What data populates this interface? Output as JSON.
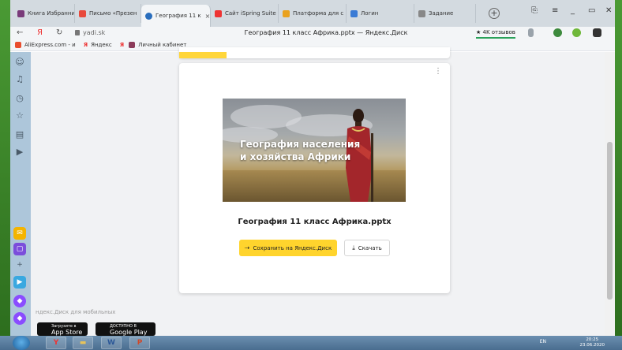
{
  "tabs": [
    {
      "label": "Книга Избранни",
      "icon": "book-icon",
      "color": "#7a3b7a"
    },
    {
      "label": "Письмо «Презен",
      "icon": "mail-icon",
      "color": "#e84a3c"
    },
    {
      "label": "География 11 к",
      "icon": "yadisk-icon",
      "color": "#2a6ebd",
      "active": true
    },
    {
      "label": "Сайт iSpring Suite",
      "icon": "yandex-icon",
      "color": "#e33"
    },
    {
      "label": "Платформа для с",
      "icon": "platform-icon",
      "color": "#e9a21f"
    },
    {
      "label": "Логин",
      "icon": "go-icon",
      "color": "#3a7bd5"
    },
    {
      "label": "Задание",
      "icon": "task-icon",
      "color": "#888"
    }
  ],
  "tab_close": "×",
  "newtab": "+",
  "window_controls": {
    "bookmark": "⎘",
    "menu": "≡",
    "minimize": "_",
    "restore": "▭",
    "close": "✕"
  },
  "address": {
    "back": "←",
    "yandex": "Я",
    "reload": "↻",
    "domain": "yadi.sk",
    "page_title": "География 11 класс Африка.pptx — Яндекс.Диск",
    "reviews": "★ 4K отзывов"
  },
  "bookmarks": [
    {
      "label": "AliExpress.com - и",
      "icon": "aliexpress-icon",
      "color": "#e94e2e"
    },
    {
      "label": "Яндекс",
      "icon": "yandex-icon",
      "color": "#e33"
    },
    {
      "label": "Личный кабинет",
      "icon": "cabinet-icon",
      "color": "#8c3b5a"
    }
  ],
  "bookmark_glyph": "Я",
  "sidebar_icons": [
    "☺",
    "♫",
    "◷",
    "☆",
    "▤",
    "▶"
  ],
  "sidebar_apps": [
    {
      "glyph": "✉",
      "color": "#f4b400"
    },
    {
      "glyph": "▢",
      "color": "#7b4ddb"
    },
    {
      "glyph": "+",
      "color": "transparent"
    },
    {
      "glyph": "▶",
      "color": "#39a8e0"
    },
    {
      "glyph": "◆",
      "color": "#8a4cff"
    },
    {
      "glyph": "◆",
      "color": "#8a4cff"
    }
  ],
  "card": {
    "more": "⋮",
    "slide_title_line1": "География населения",
    "slide_title_line2": "и хозяйства Африки",
    "filename": "География 11 класс Африка.pptx",
    "save_icon": "⇢",
    "save_label": "Сохранить на Яндекс.Диск",
    "download_icon": "⤓",
    "download_label": "Скачать"
  },
  "footer": {
    "mobile_text": "ндекс.Диск для мобильных",
    "appstore_small": "Загрузите в",
    "appstore_big": "App Store",
    "gplay_small": "ДОСТУПНО В",
    "gplay_big": "Google Play"
  },
  "taskbar": {
    "apps": [
      {
        "glyph": "Y",
        "color": "#e33"
      },
      {
        "glyph": "▬",
        "color": "#e8c35a"
      },
      {
        "glyph": "W",
        "color": "#2b5797"
      },
      {
        "glyph": "P",
        "color": "#d24726"
      }
    ],
    "lang": "EN",
    "time": "20:25",
    "date": "23.06.2020"
  }
}
